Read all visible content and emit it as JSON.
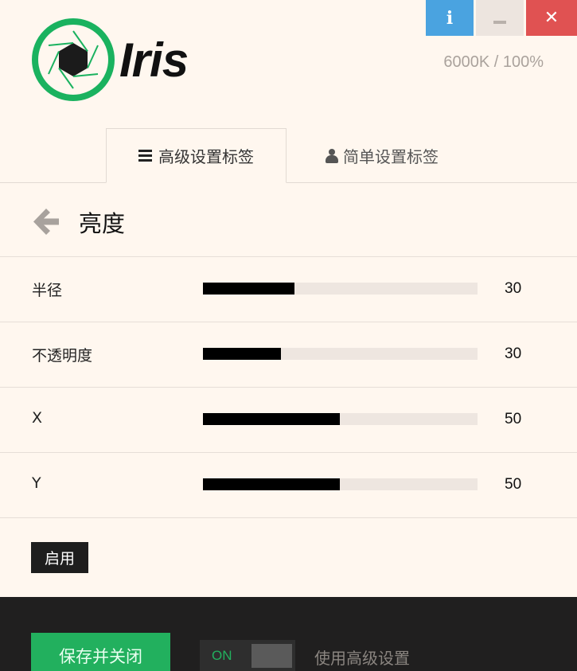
{
  "window": {
    "info_glyph": "i",
    "close_glyph": "✕"
  },
  "app": {
    "name": "Iris",
    "status": "6000K / 100%"
  },
  "tabs": [
    {
      "label": "高级设置标签",
      "icon": "menu-icon",
      "active": true
    },
    {
      "label": "简单设置标签",
      "icon": "user-icon",
      "active": false
    }
  ],
  "page": {
    "title": "亮度",
    "back_icon": "back-arrow-icon"
  },
  "sliders": [
    {
      "label": "半径",
      "value": "30",
      "fill_fraction": 0.333
    },
    {
      "label": "不透明度",
      "value": "30",
      "fill_fraction": 0.284
    },
    {
      "label": "X",
      "value": "50",
      "fill_fraction": 0.498
    },
    {
      "label": "Y",
      "value": "50",
      "fill_fraction": 0.498
    }
  ],
  "enable_button": "启用",
  "footer": {
    "save_label": "保存并关闭",
    "toggle_state": "ON",
    "toggle_label": "使用高级设置"
  },
  "colors": {
    "accent_green": "#22b05e",
    "info_blue": "#4aa3e0",
    "close_red": "#e05252",
    "background": "#fff7ef",
    "footer": "#201f1f"
  }
}
